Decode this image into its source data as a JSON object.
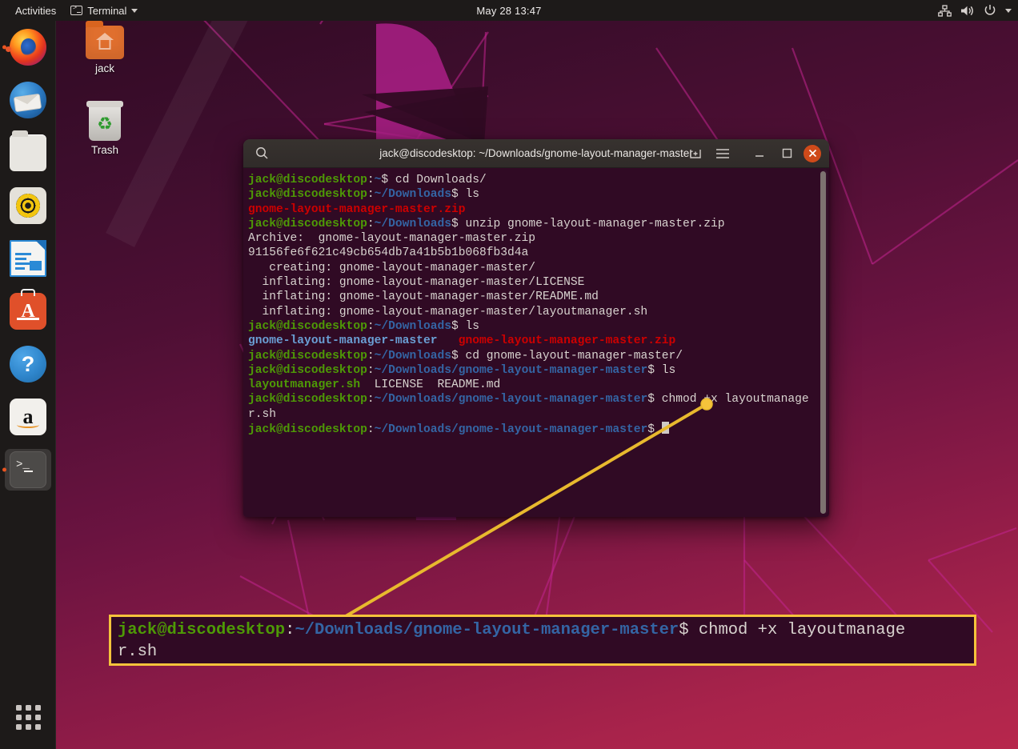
{
  "topbar": {
    "activities": "Activities",
    "app_menu": "Terminal",
    "app_icon": "terminal-icon",
    "clock": "May 28  13:47",
    "indicators": [
      "network-icon",
      "volume-icon",
      "power-icon",
      "chevron-down-icon"
    ]
  },
  "dock": {
    "items": [
      {
        "name": "firefox",
        "label": "Firefox",
        "running": true
      },
      {
        "name": "thunderbird",
        "label": "Thunderbird Mail",
        "running": false
      },
      {
        "name": "files",
        "label": "Files",
        "running": false
      },
      {
        "name": "rhythmbox",
        "label": "Rhythmbox",
        "running": false
      },
      {
        "name": "libreoffice-writer",
        "label": "LibreOffice Writer",
        "running": false
      },
      {
        "name": "ubuntu-software",
        "label": "Ubuntu Software",
        "running": false
      },
      {
        "name": "help",
        "label": "Help",
        "running": false
      },
      {
        "name": "amazon",
        "label": "Amazon",
        "running": false
      },
      {
        "name": "terminal",
        "label": "Terminal",
        "running": true
      }
    ],
    "show_apps_label": "Show Applications"
  },
  "desktop_icons": [
    {
      "name": "home-folder",
      "label": "jack"
    },
    {
      "name": "trash",
      "label": "Trash"
    }
  ],
  "terminal": {
    "title": "jack@discodesktop: ~/Downloads/gnome-layout-manager-master",
    "buttons": {
      "search": "search-icon",
      "new_tab": "new-tab-icon",
      "menu": "hamburger-menu-icon",
      "minimize": "minimize-icon",
      "maximize": "maximize-icon",
      "close": "close-icon"
    },
    "colors": {
      "background": "#300a24",
      "prompt_user": "#4e9a06",
      "prompt_path": "#3465a4",
      "zip_file": "#cc0000",
      "directory": "#6a9fd4",
      "text": "#d8d3cf"
    },
    "lines": [
      [
        {
          "t": "jack@discodesktop",
          "c": "g"
        },
        {
          "t": ":",
          "c": "w"
        },
        {
          "t": "~",
          "c": "b"
        },
        {
          "t": "$ cd Downloads/",
          "c": "w"
        }
      ],
      [
        {
          "t": "jack@discodesktop",
          "c": "g"
        },
        {
          "t": ":",
          "c": "w"
        },
        {
          "t": "~/Downloads",
          "c": "b"
        },
        {
          "t": "$ ls",
          "c": "w"
        }
      ],
      [
        {
          "t": "gnome-layout-manager-master.zip",
          "c": "r"
        }
      ],
      [
        {
          "t": "jack@discodesktop",
          "c": "g"
        },
        {
          "t": ":",
          "c": "w"
        },
        {
          "t": "~/Downloads",
          "c": "b"
        },
        {
          "t": "$ unzip gnome-layout-manager-master.zip",
          "c": "w"
        }
      ],
      [
        {
          "t": "Archive:  gnome-layout-manager-master.zip",
          "c": "w"
        }
      ],
      [
        {
          "t": "91156fe6f621c49cb654db7a41b5b1b068fb3d4a",
          "c": "w"
        }
      ],
      [
        {
          "t": "   creating: gnome-layout-manager-master/",
          "c": "w"
        }
      ],
      [
        {
          "t": "  inflating: gnome-layout-manager-master/LICENSE",
          "c": "w"
        }
      ],
      [
        {
          "t": "  inflating: gnome-layout-manager-master/README.md",
          "c": "w"
        }
      ],
      [
        {
          "t": "  inflating: gnome-layout-manager-master/layoutmanager.sh",
          "c": "w"
        }
      ],
      [
        {
          "t": "jack@discodesktop",
          "c": "g"
        },
        {
          "t": ":",
          "c": "w"
        },
        {
          "t": "~/Downloads",
          "c": "b"
        },
        {
          "t": "$ ls",
          "c": "w"
        }
      ],
      [
        {
          "t": "gnome-layout-manager-master",
          "c": "bl"
        },
        {
          "t": "   ",
          "c": "w"
        },
        {
          "t": "gnome-layout-manager-master.zip",
          "c": "r"
        }
      ],
      [
        {
          "t": "jack@discodesktop",
          "c": "g"
        },
        {
          "t": ":",
          "c": "w"
        },
        {
          "t": "~/Downloads",
          "c": "b"
        },
        {
          "t": "$ cd gnome-layout-manager-master/",
          "c": "w"
        }
      ],
      [
        {
          "t": "jack@discodesktop",
          "c": "g"
        },
        {
          "t": ":",
          "c": "w"
        },
        {
          "t": "~/Downloads/gnome-layout-manager-master",
          "c": "b"
        },
        {
          "t": "$ ls",
          "c": "w"
        }
      ],
      [
        {
          "t": "layoutmanager.sh",
          "c": "g"
        },
        {
          "t": "  LICENSE  README.md",
          "c": "w"
        }
      ],
      [
        {
          "t": "jack@discodesktop",
          "c": "g"
        },
        {
          "t": ":",
          "c": "w"
        },
        {
          "t": "~/Downloads/gnome-layout-manager-master",
          "c": "b"
        },
        {
          "t": "$ chmod +x layoutmanage",
          "c": "w"
        }
      ],
      [
        {
          "t": "r.sh",
          "c": "w"
        }
      ],
      [
        {
          "t": "jack@discodesktop",
          "c": "g"
        },
        {
          "t": ":",
          "c": "w"
        },
        {
          "t": "~/Downloads/gnome-layout-manager-master",
          "c": "b"
        },
        {
          "t": "$ ",
          "c": "w"
        },
        {
          "t": "",
          "c": "cursor"
        }
      ]
    ]
  },
  "callout": {
    "border_color": "#f5c33b",
    "line_color": "#e8b92e",
    "segments": [
      {
        "t": "jack@discodesktop",
        "c": "cg"
      },
      {
        "t": ":",
        "c": "w"
      },
      {
        "t": "~/Downloads/gnome-layout-manager-master",
        "c": "cb"
      },
      {
        "t": "$ chmod +x layoutmanage\nr.sh",
        "c": "w"
      }
    ],
    "full_text": "jack@discodesktop:~/Downloads/gnome-layout-manager-master$ chmod +x layoutmanage\nr.sh"
  }
}
